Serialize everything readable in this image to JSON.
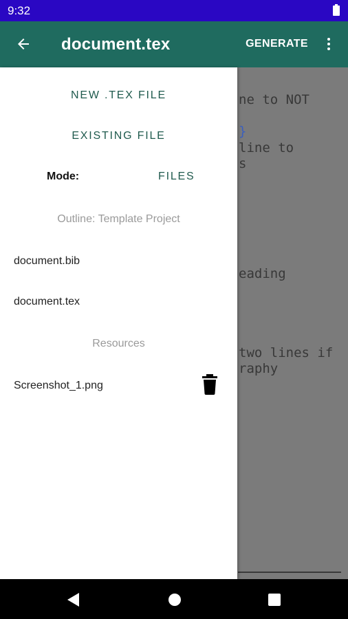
{
  "status_bar": {
    "time": "9:32",
    "battery_icon": "battery-full-icon"
  },
  "app_bar": {
    "back_icon": "arrow-back-icon",
    "title": "document.tex",
    "generate_label": "GENERATE",
    "more_icon": "more-vert-icon"
  },
  "editor": {
    "lines": [
      "ne to NOT",
      "}",
      "line to",
      "s",
      "eading",
      "two lines if",
      "raphy"
    ]
  },
  "drawer": {
    "new_file_label": "NEW .TEX FILE",
    "existing_file_label": "EXISTING FILE",
    "mode_label": "Mode:",
    "mode_value": "FILES",
    "outline_header": "Outline: Template Project",
    "outline_items": [
      "document.bib",
      "document.tex"
    ],
    "resources_header": "Resources",
    "resource_items": [
      {
        "name": "Screenshot_1.png",
        "action_icon": "delete-icon"
      }
    ]
  },
  "nav_bar": {
    "back_icon": "nav-back-icon",
    "home_icon": "nav-home-icon",
    "recents_icon": "nav-recents-icon"
  },
  "colors": {
    "status_bar": "#2a07c3",
    "app_bar": "#1f6b5f",
    "accent_text": "#1f5a4d",
    "scrim": "#7b7b7b"
  }
}
